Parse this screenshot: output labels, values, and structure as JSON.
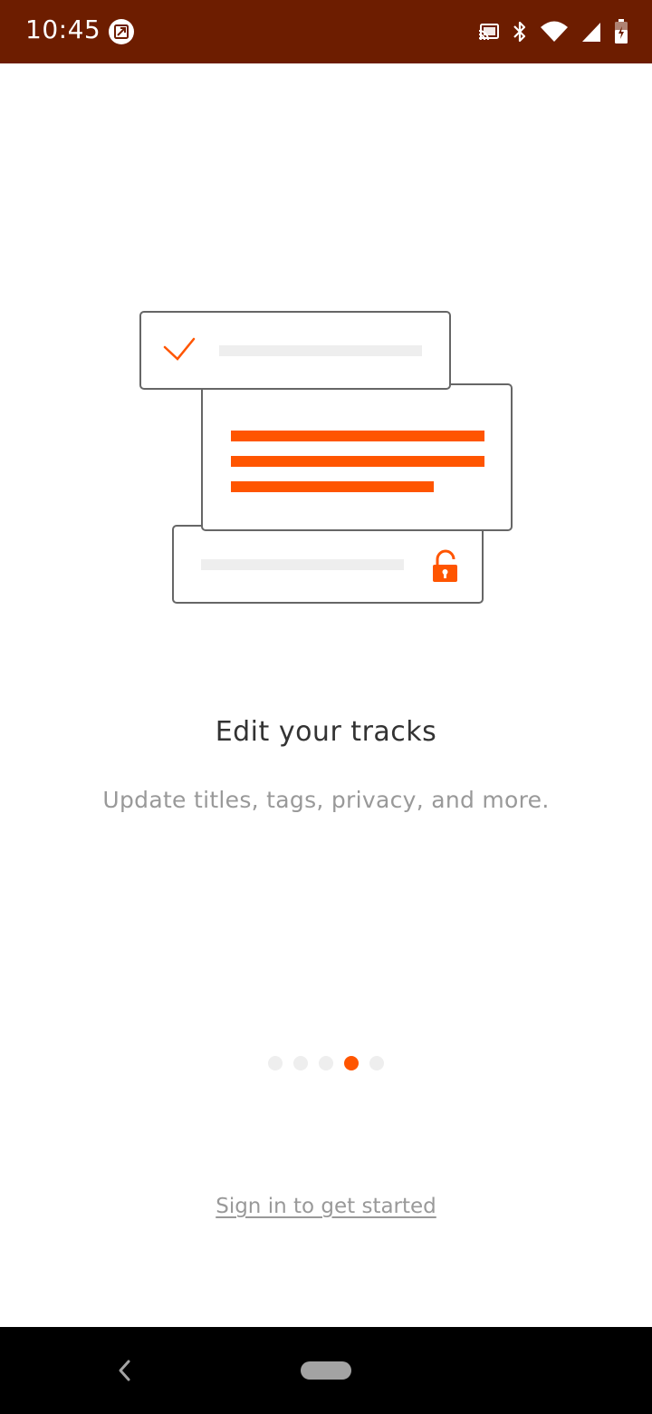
{
  "status_bar": {
    "time": "10:45",
    "background": "#6d1d00",
    "icons": [
      "image-icon",
      "cast-icon",
      "bluetooth-icon",
      "wifi-icon",
      "signal-icon",
      "battery-icon"
    ]
  },
  "onboarding": {
    "title": "Edit your tracks",
    "subtitle": "Update titles, tags, privacy, and more.",
    "pager": {
      "total": 5,
      "active_index": 3
    },
    "signin_label": "Sign in to get started"
  },
  "colors": {
    "accent": "#ff5500",
    "title": "#333333",
    "muted": "#999999",
    "dot_inactive": "#eeeeee"
  },
  "nav_bar": {
    "icons": [
      "back-icon",
      "home-pill-icon"
    ]
  }
}
